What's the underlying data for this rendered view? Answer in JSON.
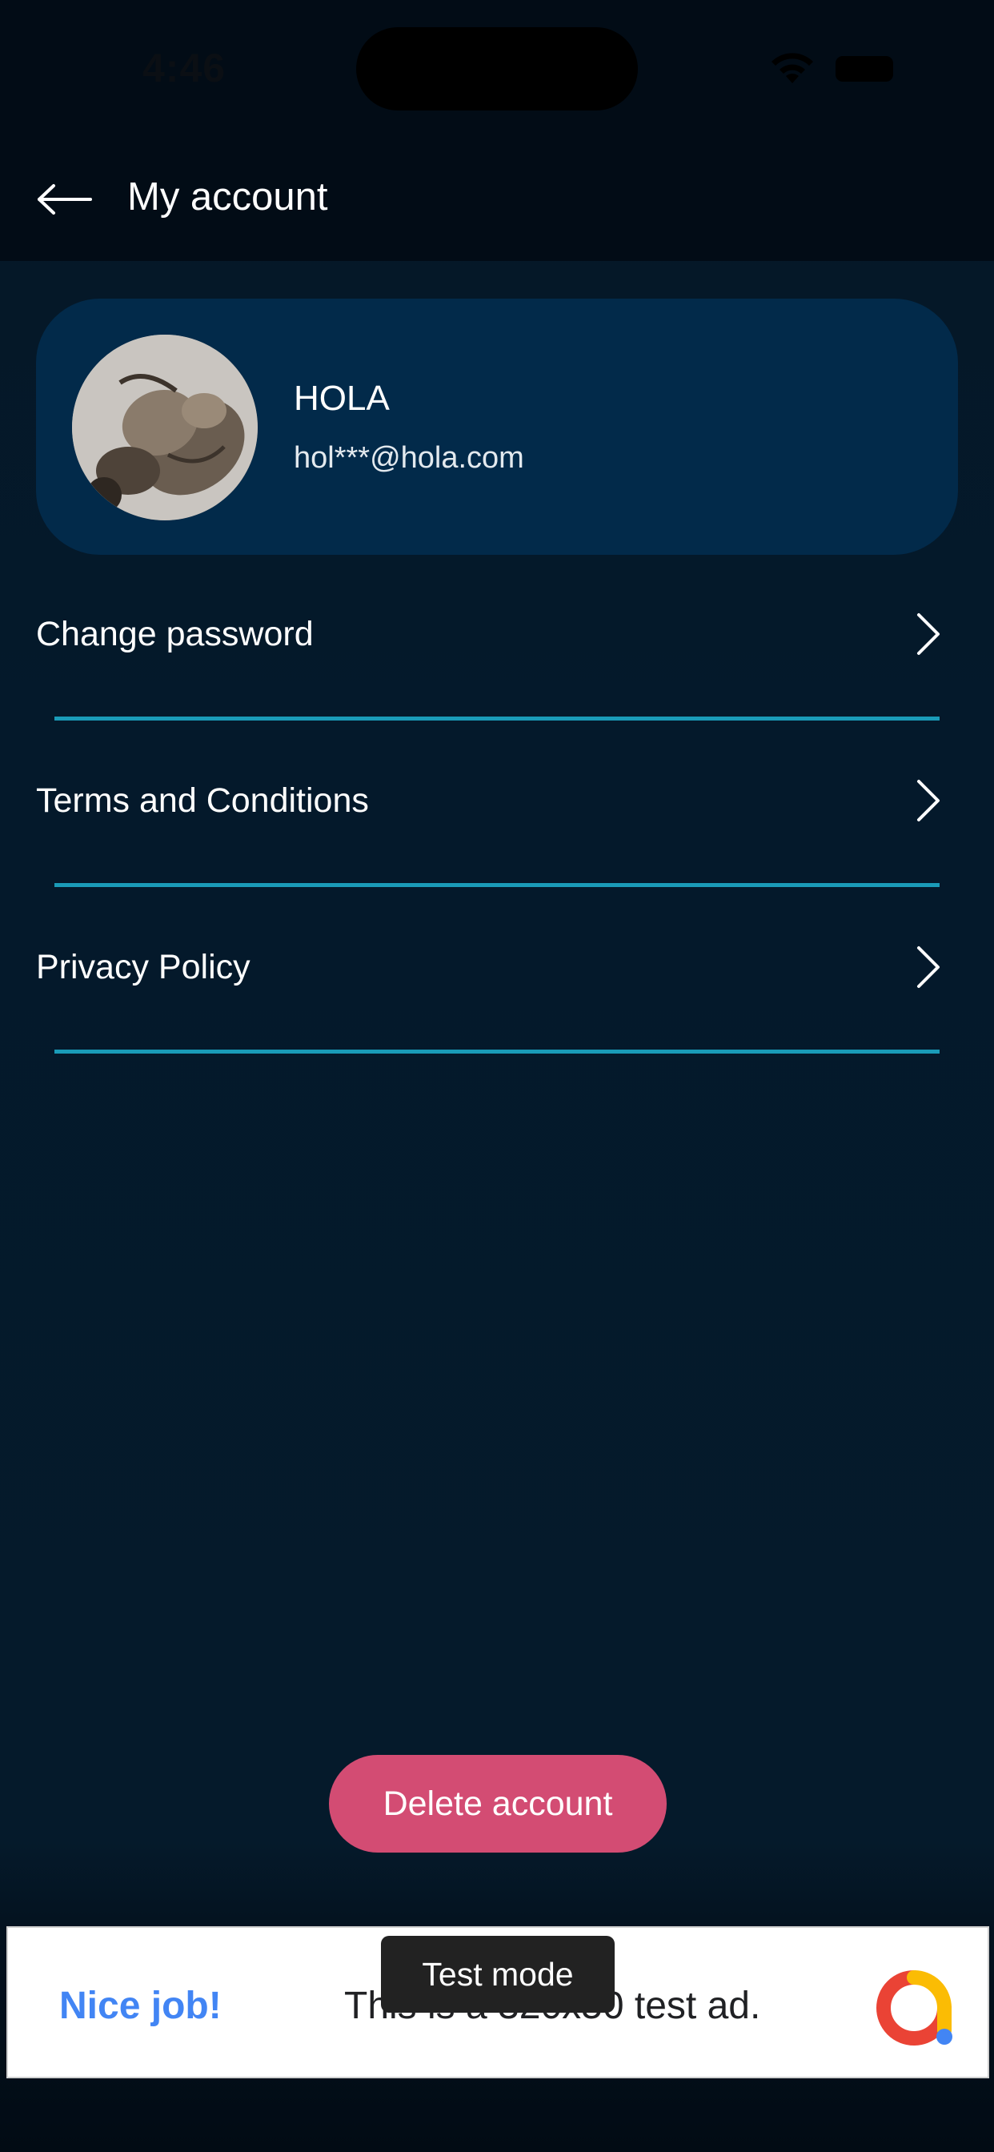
{
  "status_bar": {
    "time": "4:46",
    "icons": [
      "wifi-icon",
      "battery-icon"
    ]
  },
  "header": {
    "back_icon": "arrow-left-icon",
    "title": "My account"
  },
  "profile": {
    "name": "HOLA",
    "email": "hol***@hola.com",
    "avatar": "cat-photo"
  },
  "menu": {
    "items": [
      {
        "label": "Change password",
        "icon": "chevron-right-icon"
      },
      {
        "label": "Terms and Conditions",
        "icon": "chevron-right-icon"
      },
      {
        "label": "Privacy Policy",
        "icon": "chevron-right-icon"
      }
    ]
  },
  "actions": {
    "delete_label": "Delete account"
  },
  "ad": {
    "title": "Nice job!",
    "text": "This is a 320x50 test ad.",
    "badge": "Test mode",
    "logo": "admob-logo-icon"
  },
  "colors": {
    "background": "#051a2b",
    "card": "#022a4a",
    "divider": "#1a9bb8",
    "danger": "#d34c73",
    "ad_title": "#4285f4"
  }
}
